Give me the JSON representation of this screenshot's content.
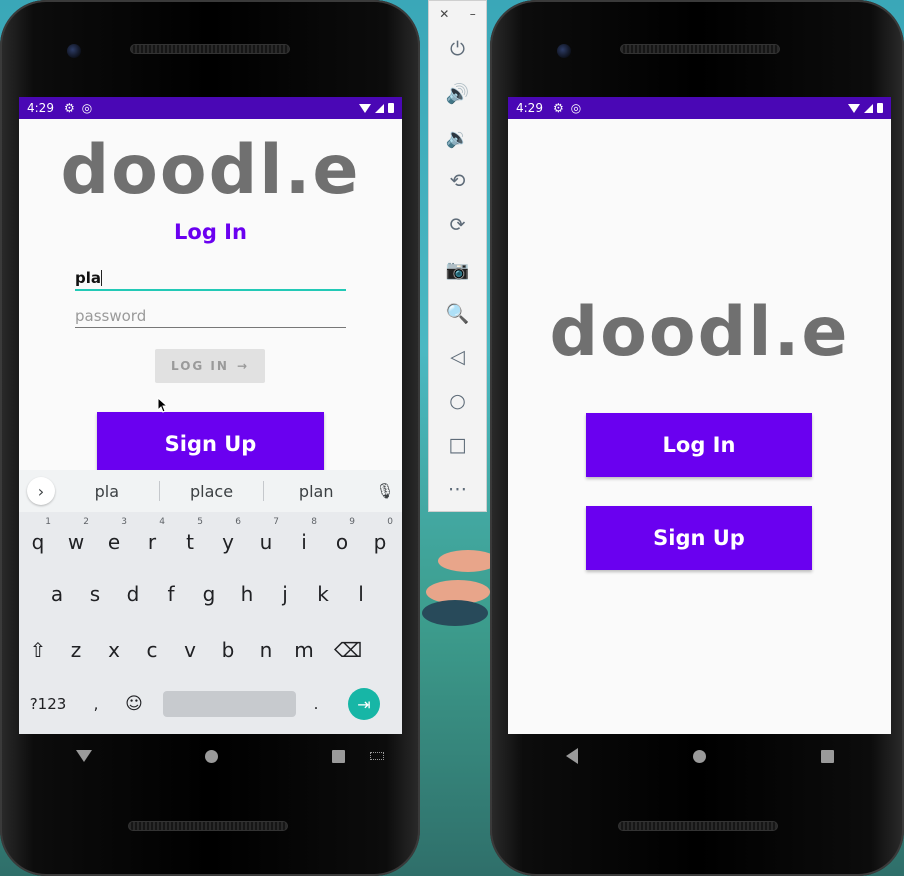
{
  "left_phone": {
    "status": {
      "time": "4:29"
    },
    "logo": "doodl.e",
    "login_title": "Log In",
    "username_value": "pla",
    "password_placeholder": "password",
    "login_button": "LOG IN",
    "signup_button": "Sign Up",
    "keyboard": {
      "suggestions": [
        "pla",
        "place",
        "plan"
      ],
      "row1": [
        {
          "k": "q",
          "n": "1"
        },
        {
          "k": "w",
          "n": "2"
        },
        {
          "k": "e",
          "n": "3"
        },
        {
          "k": "r",
          "n": "4"
        },
        {
          "k": "t",
          "n": "5"
        },
        {
          "k": "y",
          "n": "6"
        },
        {
          "k": "u",
          "n": "7"
        },
        {
          "k": "i",
          "n": "8"
        },
        {
          "k": "o",
          "n": "9"
        },
        {
          "k": "p",
          "n": "0"
        }
      ],
      "row2": [
        "a",
        "s",
        "d",
        "f",
        "g",
        "h",
        "j",
        "k",
        "l"
      ],
      "row3": [
        "z",
        "x",
        "c",
        "v",
        "b",
        "n",
        "m"
      ],
      "symbols_key": "?123",
      "comma_key": ",",
      "period_key": "."
    }
  },
  "right_phone": {
    "status": {
      "time": "4:29"
    },
    "logo": "doodl.e",
    "login_button": "Log In",
    "signup_button": "Sign Up"
  },
  "colors": {
    "accent": "#6a00f0",
    "status_bar": "#4a07b5",
    "focus_underline": "#22c9b6",
    "logo": "#707070"
  }
}
